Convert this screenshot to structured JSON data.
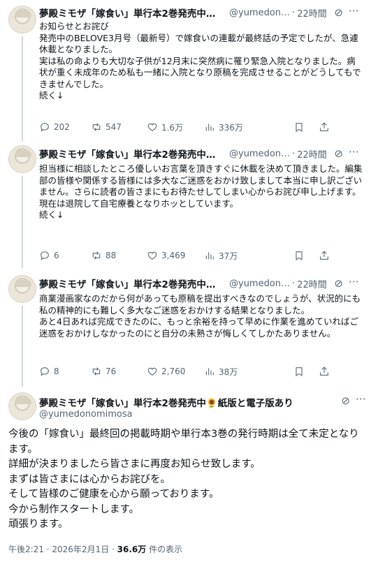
{
  "author": {
    "name": "夢殿ミモザ「嫁食い」単行本2巻発売中🌻…",
    "name_full": "夢殿ミモザ「嫁食い」単行本2巻発売中🌻紙版と電子版あり",
    "handle_short": "@yumedon…",
    "handle_full": "@yumedonomimosa"
  },
  "dot": "·",
  "tweets": [
    {
      "time": "22時間",
      "lines": [
        "お知らせとお詫び",
        "発売中のBELOVE3月号（最新号）で嫁食いの連載が最終話の予定でしたが、急遽休載となりました。",
        "実は私の命よりも大切な子供が12月末に突然病に罹り緊急入院となりました。病状が重く未成年のため私も一緒に入院となり原稿を完成させることがどうしてもできませんでした。",
        "続く↓"
      ],
      "replies": "202",
      "retweets": "547",
      "likes": "1.6万",
      "views": "336万"
    },
    {
      "time": "22時間",
      "lines": [
        "担当様に相談したところ優しいお言葉を頂きすぐに休載を決めて頂きました。編集部の皆様や関係する皆様には多大なご迷惑をおかけ致しまして本当に申し訳ございません。さらに読者の皆さまにもお待たせしてしまい心からお詫び申し上げます。",
        "現在は退院して自宅療養となりホッとしています。",
        "続く↓"
      ],
      "replies": "6",
      "retweets": "88",
      "likes": "3,469",
      "views": "37万"
    },
    {
      "time": "22時間",
      "lines": [
        "商業漫画家なのだから何があっても原稿を提出すべきなのでしょうが、状況的にも私の精神的にも難しく多大なご迷惑をおかけする結果となりました。",
        "あと4日あれば完成できたのに、もっと余裕を持って早めに作業を進めていればご迷惑をおかけしなかったのにと自分の未熟さが悔しくてしかたありません。"
      ],
      "replies": "8",
      "retweets": "76",
      "likes": "2,760",
      "views": "38万"
    }
  ],
  "main": {
    "lines": [
      "今後の「嫁食い」最終回の掲載時期や単行本3巻の発行時期は全て未定となります。",
      "詳細が決まりましたら皆さまに再度お知らせ致します。",
      "まずは皆さまには心からお詫びを。",
      "そして皆様のご健康を心から願っております。",
      "今から制作スタートします。",
      "頑張ります。"
    ],
    "timestamp": "午後2:21 · 2026年2月1日 · ",
    "views_count": "36.6万",
    "views_label": " 件の表示"
  },
  "icons": {
    "grok": "grok-icon",
    "more": "more-icon",
    "reply": "reply-icon",
    "retweet": "retweet-icon",
    "like": "heart-icon",
    "views": "views-icon",
    "bookmark": "bookmark-icon",
    "share": "share-icon"
  },
  "colors": {
    "text": "#0f1419",
    "secondary": "#536471",
    "thread_line": "#cfd9de"
  }
}
